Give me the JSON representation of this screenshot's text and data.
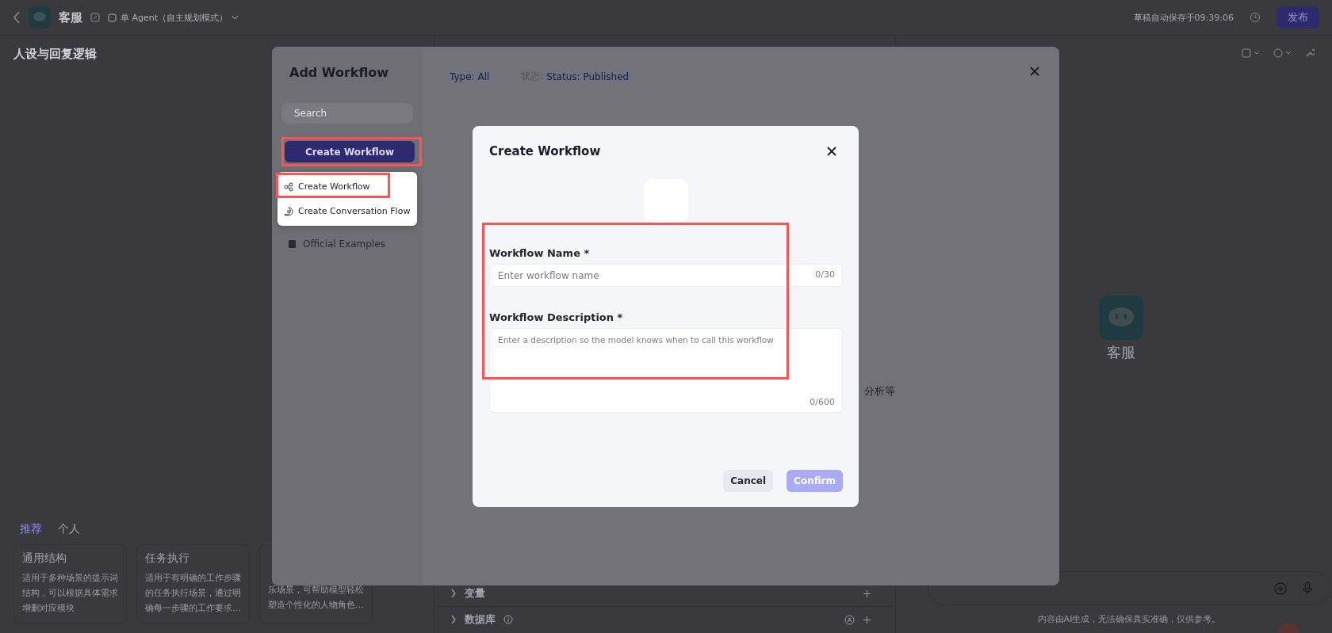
{
  "top_bar": {
    "app_name": "客服",
    "mode": "单 Agent（自主规划模式）",
    "autosave": "草稿自动保存于09:39:06",
    "publish": "发布"
  },
  "persona": {
    "title": "人设与回复逻辑",
    "tabs": [
      {
        "label": "推荐",
        "selected": true
      },
      {
        "label": "个人",
        "selected": false
      }
    ],
    "templates": [
      {
        "title": "通用结构",
        "lines": [
          "适用于多种场景的提示词",
          "结构，可以根据具体需求",
          "增删对应模块"
        ]
      },
      {
        "title": "任务执行",
        "lines": [
          "适用于有明确的工作步骤",
          "的任务执行场景，通过明",
          "确每一步骤的工作要求…"
        ]
      },
      {
        "lines": [
          "乐场景，可帮助模型轻松",
          "塑造个性化的人物角色…"
        ]
      }
    ]
  },
  "skills": {
    "partial_text": "分析等",
    "sections": [
      {
        "label": "变量",
        "info": false,
        "auto": false
      },
      {
        "label": "数据库",
        "info": true,
        "auto": true
      }
    ]
  },
  "preview": {
    "bot_name": "客服",
    "disclaimer": "内容由AI生成，无法确保真实准确，仅供参考。"
  },
  "add_workflow": {
    "title": "Add Workflow",
    "search": {
      "placeholder": "Search"
    },
    "create_button": {
      "label": "Create Workflow",
      "highlighted": true
    },
    "create_menu": [
      {
        "kind": "workflow",
        "label": "Create Workflow",
        "highlighted": true
      },
      {
        "kind": "conversation",
        "label": "Create Conversation Flow",
        "highlighted": false
      }
    ],
    "nav": [
      {
        "label": "Official Examples"
      }
    ],
    "filters": [
      {
        "label": "Type: All"
      },
      {
        "prefix": "状态:",
        "label": "Status: Published"
      }
    ]
  },
  "create_dialog": {
    "title": "Create Workflow",
    "fields_highlighted": true,
    "fields": [
      {
        "kind": "input",
        "label": "Workflow Name *",
        "placeholder": "Enter workflow name",
        "counter": "0/30"
      },
      {
        "kind": "textarea",
        "label": "Workflow Description *",
        "placeholder": "Enter a description so the model knows when to call this workflow",
        "counter": "0/600"
      }
    ],
    "buttons": [
      {
        "label": "Cancel",
        "kind": "secondary",
        "disabled": false
      },
      {
        "label": "Confirm",
        "kind": "primary",
        "disabled": true
      }
    ]
  }
}
